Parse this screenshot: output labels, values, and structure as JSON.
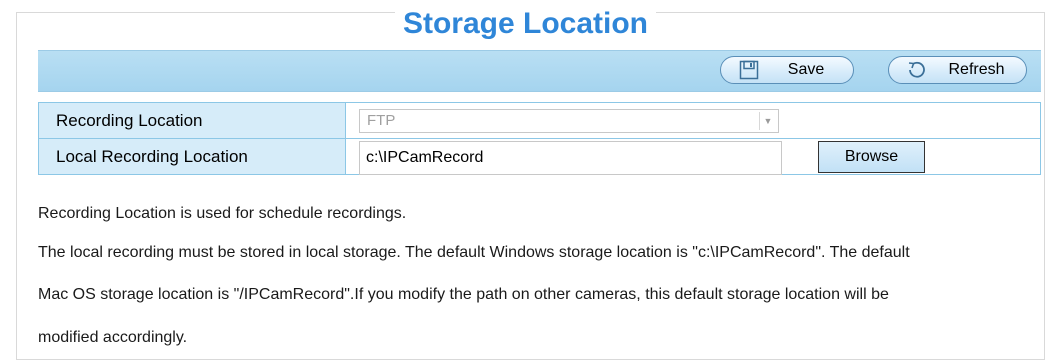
{
  "page": {
    "title": "Storage Location"
  },
  "toolbar": {
    "save_label": "Save",
    "refresh_label": "Refresh",
    "save_icon": "save-disk-icon",
    "refresh_icon": "refresh-icon"
  },
  "form": {
    "recording_location": {
      "label": "Recording Location",
      "selected": "FTP"
    },
    "local_recording_location": {
      "label": "Local Recording Location",
      "value": "c:\\IPCamRecord",
      "browse_label": "Browse"
    }
  },
  "notes": [
    "Recording Location is used for schedule recordings.",
    "The local recording must be stored in local storage. The default Windows storage location is \"c:\\IPCamRecord\". The default",
    "Mac OS storage location is \"/IPCamRecord\".If you modify the path on other cameras, this default storage location will be",
    "modified accordingly."
  ],
  "colors": {
    "title": "#2f86d8",
    "toolbar": "#b9dff3",
    "label_cell": "#d6ecf9",
    "border": "#8cc7e6"
  }
}
